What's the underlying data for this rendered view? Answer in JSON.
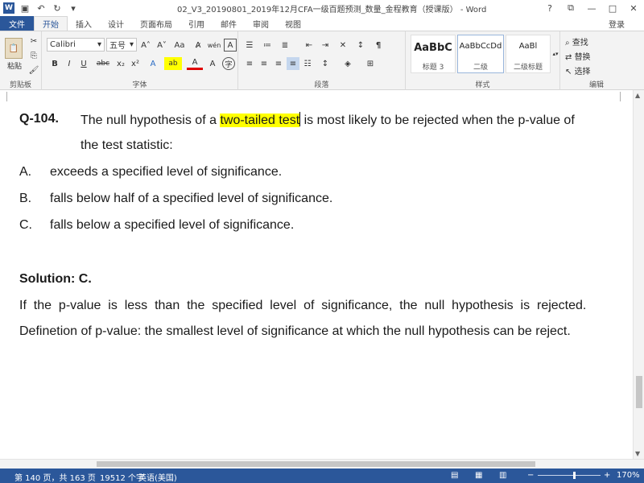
{
  "titlebar": {
    "app_icon": "W",
    "title": "02_V3_20190801_2019年12月CFA一级百题预测_数量_金程教育（授课版） - Word",
    "qat_icons": [
      "save-icon",
      "undo-icon",
      "redo-icon"
    ],
    "controls": {
      "help": "?",
      "restore": "⧉",
      "minimize": "—",
      "maximize": "□",
      "close": "✕"
    }
  },
  "tabs": [
    "文件",
    "开始",
    "插入",
    "设计",
    "页面布局",
    "引用",
    "邮件",
    "审阅",
    "视图"
  ],
  "active_tab": "开始",
  "login": "登录",
  "ribbon": {
    "clipboard": {
      "paste_label": "粘贴",
      "group_label": "剪贴板"
    },
    "font": {
      "font_name": "Calibri",
      "font_size": "五号",
      "grow": "A˄",
      "shrink": "A˅",
      "case": "Aa",
      "bold": "B",
      "italic": "I",
      "underline": "U",
      "strike": "abc",
      "subscript": "x₂",
      "superscript": "x²",
      "group_label": "字体"
    },
    "paragraph": {
      "group_label": "段落"
    },
    "styles": {
      "items": [
        {
          "sample": "AaBbC",
          "name": "标题 3"
        },
        {
          "sample": "AaBbCcDd",
          "name": "二级"
        },
        {
          "sample": "AaBl",
          "name": "二级标题"
        }
      ],
      "group_label": "样式"
    },
    "editing": {
      "find": "查找",
      "replace": "替换",
      "select": "选择",
      "group_label": "编辑"
    }
  },
  "document": {
    "question_number": "Q-104.",
    "question_part1": "The null hypothesis of a ",
    "question_highlight": "two-tailed test",
    "question_part2": " is most likely to be rejected when the p-value of",
    "question_line2": "the test statistic:",
    "options": [
      {
        "letter": "A.",
        "text": "exceeds a specified level of significance."
      },
      {
        "letter": "B.",
        "text": "falls below half of a specified level of significance."
      },
      {
        "letter": "C.",
        "text": "falls below a specified level of significance."
      }
    ],
    "solution_heading": "Solution: C.",
    "solution_line1": "If  the  p-value  is  less  than  the  specified  level  of  significance,  the  null  hypothesis  is  rejected.",
    "solution_line2": "Definetion of p-value: the smallest level of significance at which the null hypothesis can be reject.",
    "highlight_color": "#ffff00"
  },
  "statusbar": {
    "page_info": "第 140 页，共 163 页",
    "word_count": "19512 个字",
    "language": "英语(美国)",
    "zoom_minus": "−",
    "zoom_plus": "+",
    "zoom": "170%"
  },
  "colors": {
    "brand": "#2b579a",
    "ribbon_bg": "#f3f3f3"
  }
}
